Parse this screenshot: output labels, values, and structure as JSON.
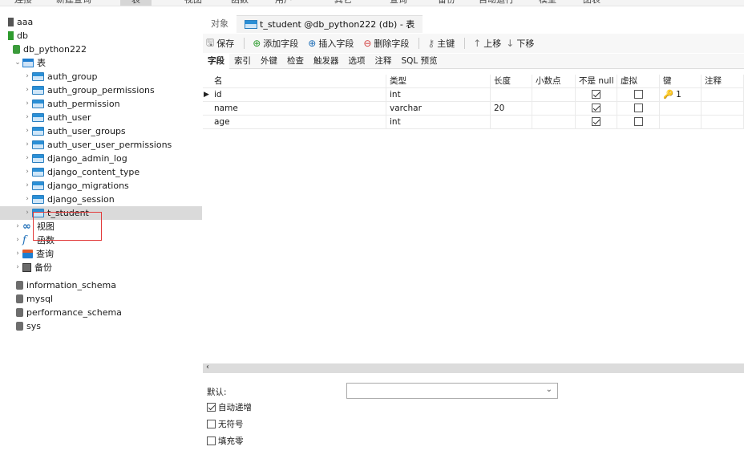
{
  "topbar": {
    "items": [
      {
        "label": "连接"
      },
      {
        "label": "新建查询"
      },
      {
        "label": "表"
      },
      {
        "label": "视图"
      },
      {
        "label": "函数"
      },
      {
        "label": "用户"
      },
      {
        "label": "其它"
      },
      {
        "label": "查询"
      },
      {
        "label": "备份"
      },
      {
        "label": "自动运行"
      },
      {
        "label": "模型"
      },
      {
        "label": "图表"
      }
    ]
  },
  "tree": {
    "connections": [
      {
        "label": "aaa"
      },
      {
        "label": "db"
      }
    ],
    "database": "db_python222",
    "tables_folder": "表",
    "tables": [
      {
        "label": "auth_group"
      },
      {
        "label": "auth_group_permissions"
      },
      {
        "label": "auth_permission"
      },
      {
        "label": "auth_user"
      },
      {
        "label": "auth_user_groups"
      },
      {
        "label": "auth_user_user_permissions"
      },
      {
        "label": "django_admin_log"
      },
      {
        "label": "django_content_type"
      },
      {
        "label": "django_migrations"
      },
      {
        "label": "django_session"
      },
      {
        "label": "t_student"
      }
    ],
    "folders": [
      {
        "label": "视图",
        "icon": "view-icon"
      },
      {
        "label": "函数",
        "icon": "function-icon"
      },
      {
        "label": "查询",
        "icon": "query-icon"
      },
      {
        "label": "备份",
        "icon": "backup-icon"
      }
    ],
    "other_databases": [
      {
        "label": "information_schema"
      },
      {
        "label": "mysql"
      },
      {
        "label": "performance_schema"
      },
      {
        "label": "sys"
      }
    ]
  },
  "tabs": [
    {
      "label": "对象"
    },
    {
      "label": "t_student @db_python222 (db) - 表"
    }
  ],
  "toolbar": {
    "save": "保存",
    "add_field": "添加字段",
    "insert_field": "插入字段",
    "delete_field": "删除字段",
    "primary_key": "主键",
    "move_up": "上移",
    "move_down": "下移"
  },
  "subtabs": [
    "字段",
    "索引",
    "外键",
    "检查",
    "触发器",
    "选项",
    "注释",
    "SQL 预览"
  ],
  "grid": {
    "columns": [
      "名",
      "类型",
      "长度",
      "小数点",
      "不是 null",
      "虚拟",
      "键",
      "注释"
    ],
    "rows": [
      {
        "name": "id",
        "type": "int",
        "length": "",
        "decimals": "",
        "not_null": true,
        "virtual": false,
        "key": "1"
      },
      {
        "name": "name",
        "type": "varchar",
        "length": "20",
        "decimals": "",
        "not_null": true,
        "virtual": false,
        "key": ""
      },
      {
        "name": "age",
        "type": "int",
        "length": "",
        "decimals": "",
        "not_null": true,
        "virtual": false,
        "key": ""
      }
    ]
  },
  "props": {
    "default_label": "默认:",
    "default_value": "",
    "auto_increment": {
      "label": "自动递增",
      "checked": true
    },
    "unsigned": {
      "label": "无符号",
      "checked": false
    },
    "zerofill": {
      "label": "填充零",
      "checked": false
    }
  },
  "colors": {
    "selection": "#dadada",
    "accent": "#1f6fb8",
    "highlight_border": "#e23b3b"
  }
}
